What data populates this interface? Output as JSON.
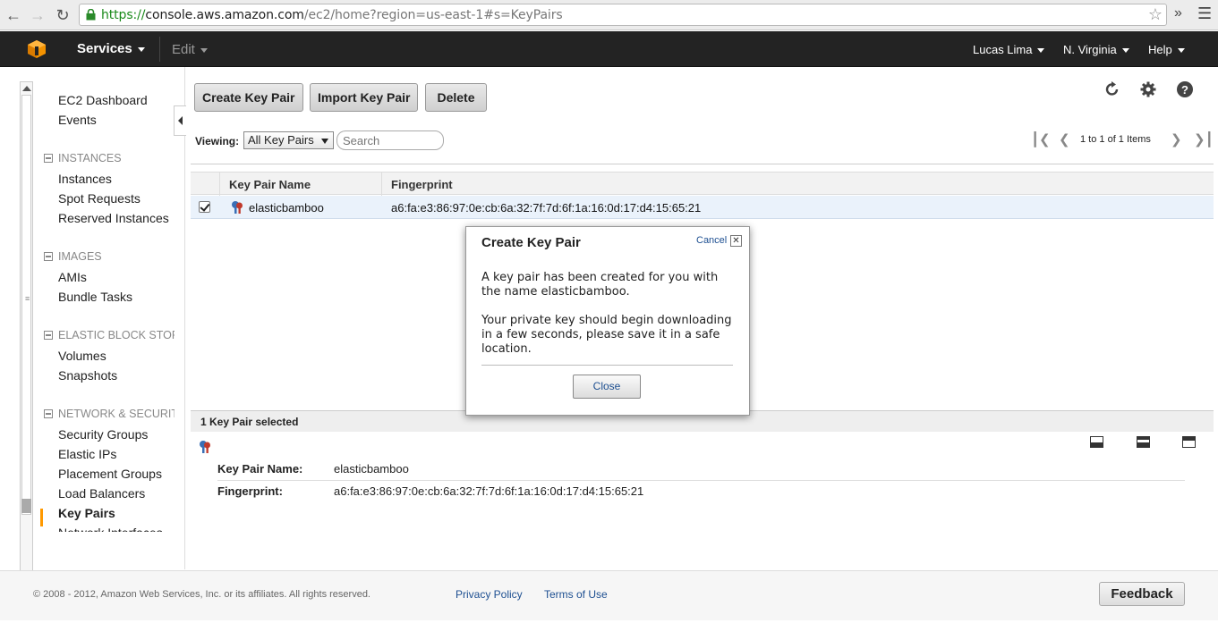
{
  "browser": {
    "url_scheme": "https://",
    "url_host": "console.aws.amazon.com",
    "url_path": "/ec2/home?region=us-east-1#s=KeyPairs"
  },
  "topnav": {
    "services": "Services",
    "edit": "Edit",
    "user": "Lucas Lima",
    "region": "N. Virginia",
    "help": "Help"
  },
  "sidebar": {
    "ec2_dashboard": "EC2 Dashboard",
    "events": "Events",
    "instances_section": "INSTANCES",
    "instances": "Instances",
    "spot_requests": "Spot Requests",
    "reserved_instances": "Reserved Instances",
    "images_section": "IMAGES",
    "amis": "AMIs",
    "bundle_tasks": "Bundle Tasks",
    "ebs_section": "ELASTIC BLOCK STORE",
    "volumes": "Volumes",
    "snapshots": "Snapshots",
    "network_section": "NETWORK & SECURITY",
    "security_groups": "Security Groups",
    "elastic_ips": "Elastic IPs",
    "placement_groups": "Placement Groups",
    "load_balancers": "Load Balancers",
    "key_pairs": "Key Pairs",
    "network_interfaces": "Network Interfaces"
  },
  "toolbar": {
    "create": "Create Key Pair",
    "import": "Import Key Pair",
    "delete": "Delete"
  },
  "filter": {
    "viewing_label": "Viewing:",
    "viewing_value": "All Key Pairs",
    "search_placeholder": "Search",
    "pager_text": "1 to 1 of 1 Items"
  },
  "grid": {
    "col_name": "Key Pair Name",
    "col_fingerprint": "Fingerprint",
    "rows": [
      {
        "name": "elasticbamboo",
        "fingerprint": "a6:fa:e3:86:97:0e:cb:6a:32:7f:7d:6f:1a:16:0d:17:d4:15:65:21"
      }
    ]
  },
  "details": {
    "selected": "1 Key Pair selected",
    "name_label": "Key Pair Name:",
    "name_value": "elasticbamboo",
    "fp_label": "Fingerprint:",
    "fp_value": "a6:fa:e3:86:97:0e:cb:6a:32:7f:7d:6f:1a:16:0d:17:d4:15:65:21"
  },
  "modal": {
    "title": "Create Key Pair",
    "cancel": "Cancel",
    "p1": "A key pair has been created for you with the name elasticbamboo.",
    "p2": "Your private key should begin downloading in a few seconds, please save it in a safe location.",
    "close": "Close"
  },
  "footer": {
    "copyright": "© 2008 - 2012, Amazon Web Services, Inc. or its affiliates. All rights reserved.",
    "privacy": "Privacy Policy",
    "terms": "Terms of Use",
    "feedback": "Feedback"
  },
  "colors": {
    "accent": "#ff9900",
    "link": "#1d4f91",
    "nav_bg": "#232323",
    "selected_row": "#eaf2fb"
  }
}
